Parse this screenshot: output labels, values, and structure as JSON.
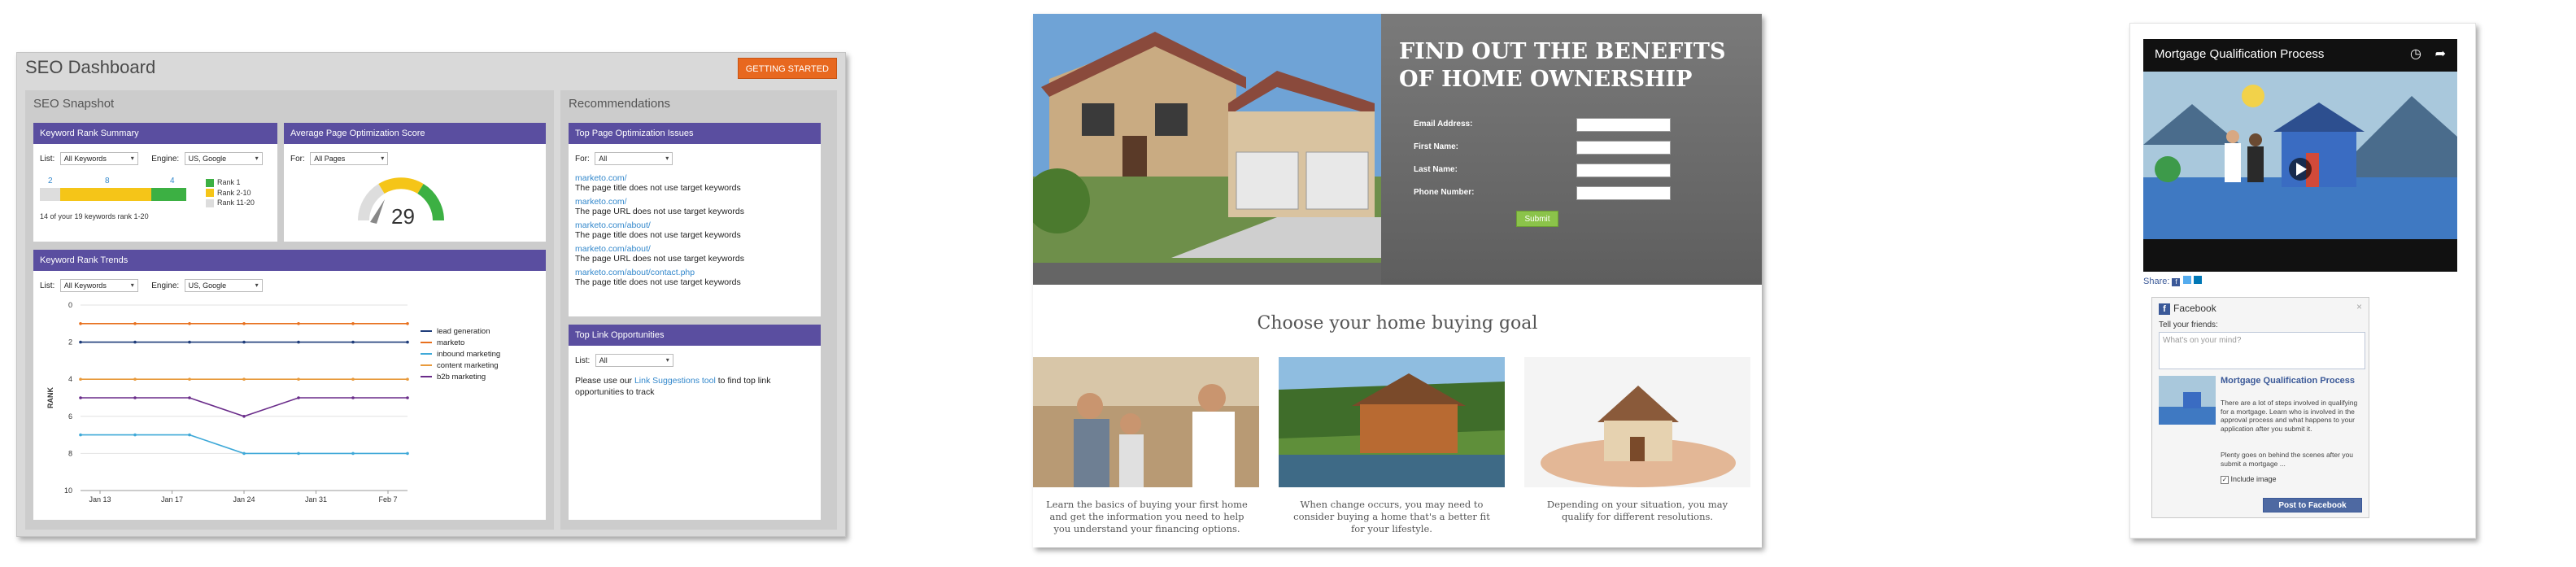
{
  "seo": {
    "title": "SEO Dashboard",
    "getting_started": "GETTING STARTED",
    "snapshot_title": "SEO Snapshot",
    "recommendations_title": "Recommendations",
    "keyword_rank_summary": {
      "title": "Keyword Rank Summary",
      "list_label": "List:",
      "list_value": "All Keywords",
      "engine_label": "Engine:",
      "engine_value": "US, Google",
      "counts": [
        "2",
        "8",
        "4"
      ],
      "legend": [
        "Rank 1",
        "Rank 2-10",
        "Rank 11-20"
      ],
      "legend_colors": [
        "#3cb043",
        "#f5c518",
        "#dddddd"
      ],
      "footnote": "14 of your 19 keywords rank 1-20"
    },
    "page_opt_score": {
      "title": "Average Page Optimization Score",
      "for_label": "For:",
      "for_value": "All Pages",
      "score": "29"
    },
    "keyword_rank_trends": {
      "title": "Keyword Rank Trends",
      "list_label": "List:",
      "list_value": "All Keywords",
      "engine_label": "Engine:",
      "engine_value": "US, Google"
    },
    "top_page_issues": {
      "title": "Top Page Optimization Issues",
      "for_label": "For:",
      "for_value": "All",
      "items": [
        {
          "url": "marketo.com/",
          "issue": "The page title does not use target keywords"
        },
        {
          "url": "marketo.com/",
          "issue": "The page URL does not use target keywords"
        },
        {
          "url": "marketo.com/about/",
          "issue": "The page title does not use target keywords"
        },
        {
          "url": "marketo.com/about/",
          "issue": "The page URL does not use target keywords"
        },
        {
          "url": "marketo.com/about/contact.php",
          "issue": "The page title does not use target keywords"
        }
      ]
    },
    "top_link": {
      "title": "Top Link Opportunities",
      "list_label": "List:",
      "list_value": "All",
      "text_before": "Please use our ",
      "link": "Link Suggestions tool",
      "text_after": " to find top link opportunities to track"
    }
  },
  "home": {
    "headline_1": "FIND OUT THE BENEFITS",
    "headline_2": "OF HOME OWNERSHIP",
    "form": {
      "email": "Email Address:",
      "first": "First Name:",
      "last": "Last Name:",
      "phone": "Phone Number:",
      "submit": "Submit"
    },
    "goal_title": "Choose your home buying goal",
    "captions": [
      "Learn the basics of buying your first home and get the information you need to help you understand your financing options.",
      "When change occurs, you may need to consider buying a home that's a better fit for your lifestyle.",
      "Depending on your situation, you may qualify for different resolutions."
    ]
  },
  "share": {
    "video_title": "Mortgage Qualification Process",
    "share_label": "Share:",
    "facebook_title": "Facebook",
    "close": "×",
    "tell_friends": "Tell your friends:",
    "placeholder": "What's on your mind?",
    "card_title": "Mortgage Qualification Process",
    "card_body_1": "There are a lot of steps involved in qualifying for a mortgage. Learn who is involved in the approval process and what happens to your application after you submit it.",
    "card_body_2": "Plenty goes on behind the scenes after you submit a mortgage ...",
    "include_image": "Include image",
    "post_button": "Post to Facebook"
  },
  "chart_data": {
    "type": "line",
    "title": "",
    "xlabel": "",
    "ylabel": "RANK",
    "x": [
      "Jan 13",
      "Jan 17",
      "Jan 24",
      "Jan 31",
      "Feb 7"
    ],
    "y_ticks": [
      "0",
      "2",
      "4",
      "6",
      "8",
      "10"
    ],
    "ylim": [
      0,
      10
    ],
    "y_inverted": true,
    "legend_position": "right",
    "series": [
      {
        "name": "lead generation",
        "color": "#1f3d7a",
        "values": [
          2,
          2,
          2,
          2,
          2,
          2,
          2
        ]
      },
      {
        "name": "marketo",
        "color": "#e8701e",
        "values": [
          1,
          1,
          1,
          1,
          1,
          1,
          1
        ]
      },
      {
        "name": "inbound marketing",
        "color": "#3fa9d8",
        "values": [
          7,
          7,
          7,
          8,
          8,
          8,
          8
        ]
      },
      {
        "name": "content marketing",
        "color": "#e89a3c",
        "values": [
          4,
          4,
          4,
          4,
          4,
          4,
          4
        ]
      },
      {
        "name": "b2b marketing",
        "color": "#6a2c8a",
        "values": [
          5,
          5,
          5,
          6,
          5,
          5,
          5
        ]
      }
    ]
  }
}
